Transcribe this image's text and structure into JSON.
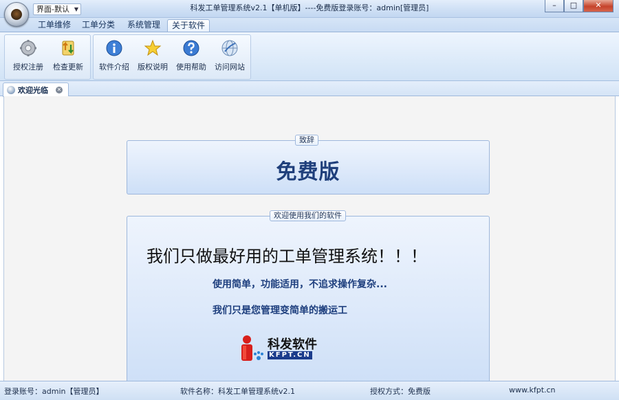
{
  "window": {
    "title": "科发工单管理系统v2.1【单机版】----免费版登录账号：admin[管理员]",
    "theme_label": "界面-默认",
    "minimize": "–",
    "maximize": "□",
    "close": "✕"
  },
  "ribbon": {
    "tabs": [
      "工单维修",
      "工单分类",
      "系统管理",
      "关于软件"
    ],
    "active_tab": "关于软件",
    "buttons": [
      {
        "label": "授权注册",
        "icon": "gear-icon"
      },
      {
        "label": "检查更新",
        "icon": "update-icon"
      },
      {
        "label": "软件介绍",
        "icon": "info-icon"
      },
      {
        "label": "版权说明",
        "icon": "star-icon"
      },
      {
        "label": "使用帮助",
        "icon": "help-icon"
      },
      {
        "label": "访问网站",
        "icon": "globe-icon"
      }
    ]
  },
  "doc_tab": {
    "label": "欢迎光临",
    "icon": "welcome-icon"
  },
  "main": {
    "panel1": {
      "caption": "致辞",
      "edition": "免费版"
    },
    "panel2": {
      "caption": "欢迎使用我们的软件",
      "slogan": "我们只做最好用的工单管理系统！！！",
      "line1": "使用简单，功能适用，不追求操作复杂...",
      "line2": "我们只是您管理变简单的搬运工",
      "logo_title": "科发软件",
      "logo_domain": "KFPT.CN"
    }
  },
  "status": {
    "account": "登录账号：admin【管理员】",
    "software": "软件名称：科发工单管理系统v2.1",
    "license": "授权方式：免费版",
    "website": "www.kfpt.cn"
  },
  "colors": {
    "ribbon_bg": "#dceaf9",
    "accent_text": "#1f3f7b",
    "close_button": "#c5432b"
  }
}
